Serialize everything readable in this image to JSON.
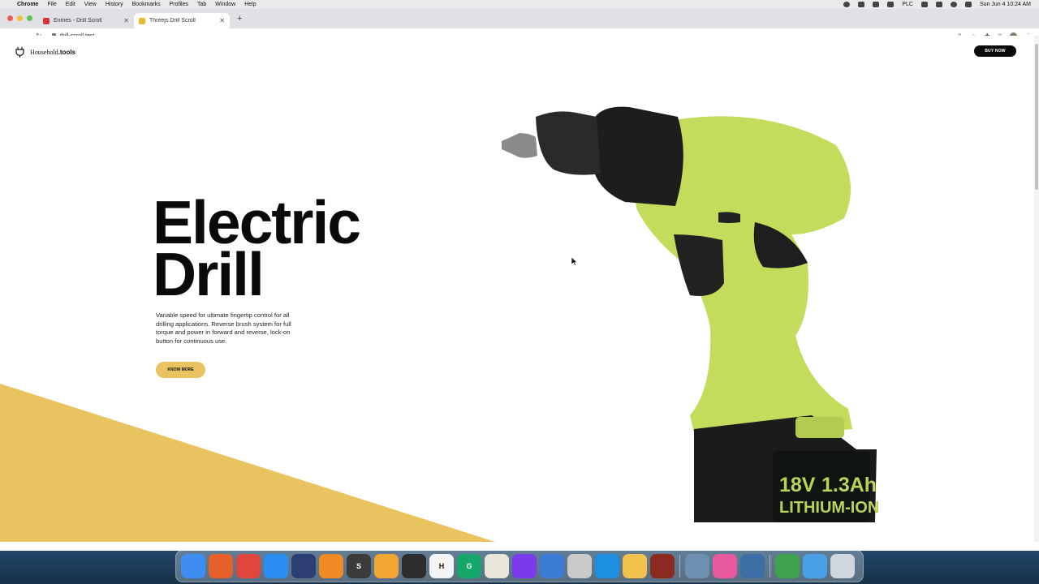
{
  "menubar": {
    "app_name": "Chrome",
    "menus": [
      "File",
      "Edit",
      "View",
      "History",
      "Bookmarks",
      "Profiles",
      "Tab",
      "Window",
      "Help"
    ],
    "status_label": "PLC",
    "clock": "Sun Jun 4  10:24 AM"
  },
  "browser": {
    "tabs": [
      {
        "title": "Entries - Drill Scroll",
        "favicon": "craft-red"
      },
      {
        "title": "Threejs Drill Scroll",
        "favicon": "yellow-square"
      }
    ],
    "active_tab": 1,
    "new_tab_label": "+",
    "address": "drill-scroll.test"
  },
  "page": {
    "brand_name": "Household",
    "brand_suffix": ".tools",
    "buy_now": "BUY NOW",
    "hero_line1": "Electric",
    "hero_line2": "Drill",
    "description": "Variable speed for ultimate fingertip control for all drilling applications. Reverse brush system for full torque and power in forward and reverse, lock-on button for continuous use.",
    "cta": "KNOW MORE",
    "battery_voltage": "18V",
    "battery_capacity": "1.3Ah",
    "battery_type": "LITHIUM-ION",
    "accent_color": "#e8c360",
    "drill_color": "#c3dc5c"
  },
  "dock": {
    "apps": [
      {
        "name": "finder",
        "color": "#3d8ef0",
        "glyph": ""
      },
      {
        "name": "firefox",
        "color": "#e8602a",
        "glyph": ""
      },
      {
        "name": "chrome",
        "color": "#e0463c",
        "glyph": ""
      },
      {
        "name": "safari",
        "color": "#2a8ef5",
        "glyph": ""
      },
      {
        "name": "cinema4d",
        "color": "#2c3e73",
        "glyph": ""
      },
      {
        "name": "blender",
        "color": "#f08a24",
        "glyph": ""
      },
      {
        "name": "sublime",
        "color": "#3b3b3b",
        "glyph": "S"
      },
      {
        "name": "maps",
        "color": "#f2a531",
        "glyph": ""
      },
      {
        "name": "obs",
        "color": "#2d2d2d",
        "glyph": ""
      },
      {
        "name": "hemingway",
        "color": "#f4f4f4",
        "glyph": "H"
      },
      {
        "name": "grammarly",
        "color": "#15a66a",
        "glyph": "G"
      },
      {
        "name": "textedit",
        "color": "#e9e5d8",
        "glyph": ""
      },
      {
        "name": "github",
        "color": "#7c3aed",
        "glyph": ""
      },
      {
        "name": "tableplus",
        "color": "#3a7bd5",
        "glyph": ""
      },
      {
        "name": "sequel",
        "color": "#c9c9c9",
        "glyph": ""
      },
      {
        "name": "docker",
        "color": "#1d8fe3",
        "glyph": ""
      },
      {
        "name": "transmit",
        "color": "#f3c24c",
        "glyph": ""
      },
      {
        "name": "photobooth",
        "color": "#8c2a20",
        "glyph": ""
      },
      {
        "name": "preview",
        "color": "#6f8fb0",
        "glyph": ""
      },
      {
        "name": "cleanmymac",
        "color": "#e85aa0",
        "glyph": ""
      },
      {
        "name": "quicktime",
        "color": "#3a6ea5",
        "glyph": ""
      },
      {
        "name": "migration",
        "color": "#3fa34d",
        "glyph": ""
      },
      {
        "name": "downloads",
        "color": "#4aa0e6",
        "glyph": ""
      },
      {
        "name": "trash",
        "color": "#cfd6dc",
        "glyph": ""
      }
    ]
  }
}
